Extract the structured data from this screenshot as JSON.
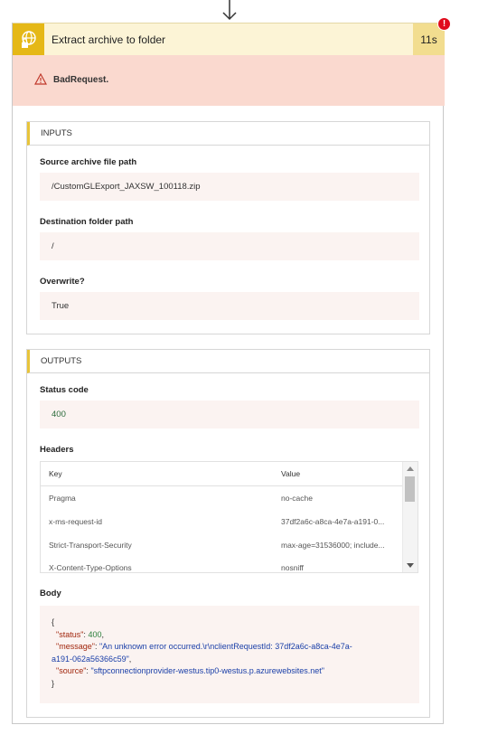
{
  "action": {
    "title": "Extract archive to folder",
    "duration": "11s",
    "error_badge": "!",
    "error_message": "BadRequest."
  },
  "inputs": {
    "heading": "INPUTS",
    "fields": [
      {
        "label": "Source archive file path",
        "value": "/CustomGLExport_JAXSW_100118.zip"
      },
      {
        "label": "Destination folder path",
        "value": "/"
      },
      {
        "label": "Overwrite?",
        "value": "True"
      }
    ]
  },
  "outputs": {
    "heading": "OUTPUTS",
    "status_label": "Status code",
    "status_value": "400",
    "headers_label": "Headers",
    "headers_columns": [
      "Key",
      "Value"
    ],
    "headers_rows": [
      {
        "key": "Pragma",
        "value": "no-cache"
      },
      {
        "key": "x-ms-request-id",
        "value": "37df2a6c-a8ca-4e7a-a191-0..."
      },
      {
        "key": "Strict-Transport-Security",
        "value": "max-age=31536000; include..."
      },
      {
        "key": "X-Content-Type-Options",
        "value": "nosniff"
      }
    ],
    "body_label": "Body",
    "body": {
      "open": "{",
      "close": "}",
      "status_key": "\"status\"",
      "status_val": "400",
      "message_key": "\"message\"",
      "message_val_1": "\"An unknown error occurred.\\r\\nclientRequestId: 37df2a6c-a8ca-4e7a-",
      "message_val_2": "a191-062a56366c59\"",
      "source_key": "\"source\"",
      "source_val": "\"sftpconnectionprovider-westus.tip0-westus.p.azurewebsites.net\""
    }
  },
  "colors": {
    "header_bg": "#fcf4d6",
    "icon_bg": "#e5b817",
    "error_banner": "#fad9cf",
    "error_dot": "#e00b1c",
    "section_accent": "#e8c43a"
  }
}
